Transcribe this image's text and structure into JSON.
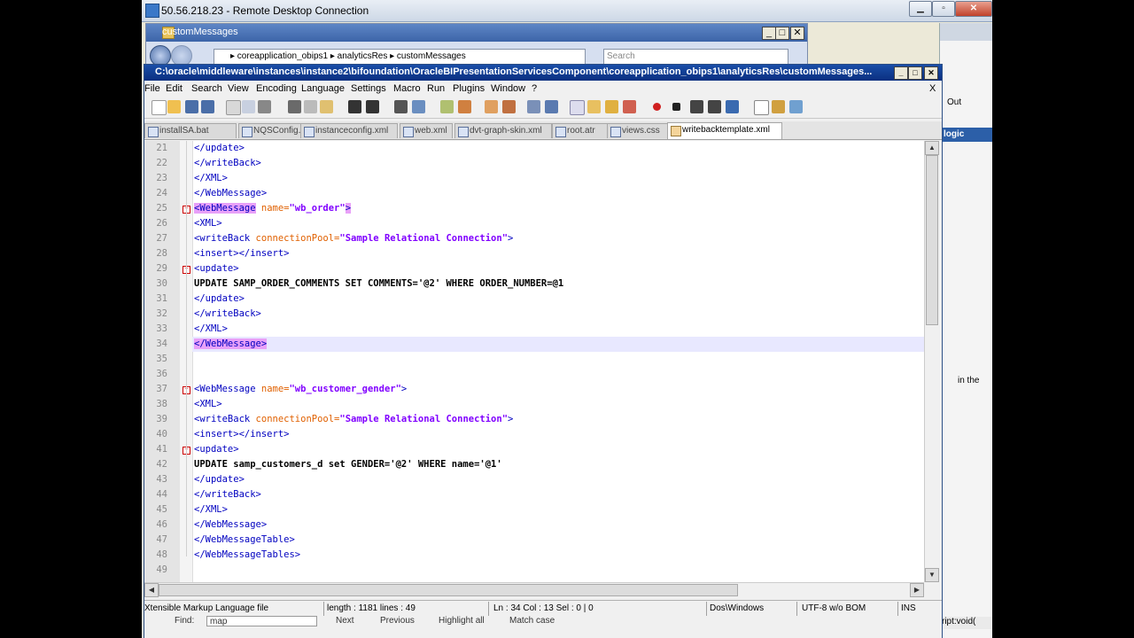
{
  "rdc": {
    "title": "50.56.218.23 - Remote Desktop Connection"
  },
  "explorer": {
    "title": "customMessages",
    "address": "▸  coreapplication_obips1  ▸  analyticsRes  ▸  customMessages",
    "search_placeholder": "Search"
  },
  "browser": {
    "out_label": "Out",
    "logic_label": "logic",
    "in_the": "in the",
    "js_void": "ript:void("
  },
  "npp": {
    "title": "C:\\oracle\\middleware\\instances\\instance2\\bifoundation\\OracleBIPresentationServicesComponent\\coreapplication_obips1\\analyticsRes\\customMessages...",
    "menu": [
      "File",
      "Edit",
      "Search",
      "View",
      "Encoding",
      "Language",
      "Settings",
      "Macro",
      "Run",
      "Plugins",
      "Window",
      "?"
    ],
    "close_x": "X",
    "tabs": [
      "installSA.bat",
      "NQSConfig.INI",
      "instanceconfig.xml",
      "web.xml",
      "dvt-graph-skin.xml",
      "root.atr",
      "views.css",
      "writebacktemplate.xml"
    ],
    "lines": [
      {
        "n": "21",
        "text": "</update>"
      },
      {
        "n": "22",
        "text": "</writeBack>"
      },
      {
        "n": "23",
        "text": "</XML>"
      },
      {
        "n": "24",
        "text": "</WebMessage>"
      },
      {
        "n": "25",
        "tag": "<WebMessage",
        "attr": "name=",
        "val": "\"wb_order\"",
        "end": ">"
      },
      {
        "n": "26",
        "text": "<XML>"
      },
      {
        "n": "27",
        "tag": "<writeBack",
        "attr": "connectionPool=",
        "val": "\"Sample Relational Connection\"",
        "end": ">"
      },
      {
        "n": "28",
        "text": "<insert></insert>"
      },
      {
        "n": "29",
        "text": "<update>"
      },
      {
        "n": "30",
        "plain": "UPDATE SAMP_ORDER_COMMENTS SET COMMENTS='@2' WHERE ORDER_NUMBER=@1"
      },
      {
        "n": "31",
        "text": "</update>"
      },
      {
        "n": "32",
        "text": "</writeBack>"
      },
      {
        "n": "33",
        "text": "</XML>"
      },
      {
        "n": "34",
        "text": "</WebMessage>"
      },
      {
        "n": "35",
        "text": ""
      },
      {
        "n": "36",
        "text": ""
      },
      {
        "n": "37",
        "tag": "<WebMessage",
        "attr": "name=",
        "val": "\"wb_customer_gender\"",
        "end": ">"
      },
      {
        "n": "38",
        "text": "<XML>"
      },
      {
        "n": "39",
        "tag": "<writeBack",
        "attr": "connectionPool=",
        "val": "\"Sample Relational Connection\"",
        "end": ">"
      },
      {
        "n": "40",
        "text": "<insert></insert>"
      },
      {
        "n": "41",
        "text": "<update>"
      },
      {
        "n": "42",
        "plain": "UPDATE samp_customers_d set GENDER='@2' WHERE name='@1'"
      },
      {
        "n": "43",
        "text": "</update>"
      },
      {
        "n": "44",
        "text": "</writeBack>"
      },
      {
        "n": "45",
        "text": "</XML>"
      },
      {
        "n": "46",
        "text": "</WebMessage>"
      },
      {
        "n": "47",
        "text": "</WebMessageTable>"
      },
      {
        "n": "48",
        "text": "</WebMessageTables>"
      },
      {
        "n": "49",
        "text": ""
      }
    ],
    "status": {
      "filetype": "Xtensible Markup Language file",
      "length": "length : 1181    lines : 49",
      "pos": "Ln : 34    Col : 13    Sel : 0 | 0",
      "eol": "Dos\\Windows",
      "enc": "UTF-8 w/o BOM",
      "mode": "INS"
    },
    "findbar": {
      "find": "Find:",
      "value": "map",
      "next": "Next",
      "previous": "Previous",
      "highlight": "Highlight all",
      "matchcase": "Match case"
    }
  },
  "colors": {
    "tag": "#0000c0",
    "attr": "#e06000",
    "value": "#8000ff",
    "highlight": "#e8a0f8",
    "current_line": "#e8e8ff"
  }
}
